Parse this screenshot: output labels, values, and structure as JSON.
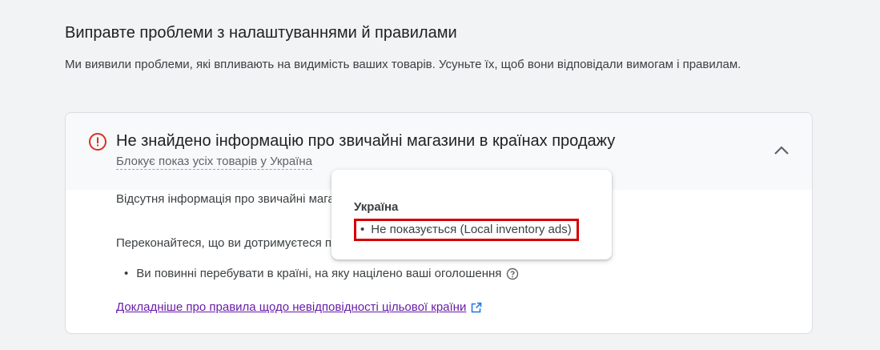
{
  "section": {
    "title": "Виправте проблеми з налаштуваннями й правилами",
    "description": "Ми виявили проблеми, які впливають на видимість ваших товарів. Усуньте їх, щоб вони відповідали вимогам і правилам."
  },
  "issue": {
    "icon": "error-icon",
    "title": "Не знайдено інформацію про звичайні магазини в країнах продажу",
    "subtitle": "Блокує показ усіх товарів у Україна",
    "collapse_icon": "chevron-up-icon",
    "body_p1": "Відсутня інформація про звичайні магазини в країнах, де ви продаєте товари",
    "body_p2": "Переконайтеся, що ви дотримуєтеся правил.",
    "bullet": "Ви повинні перебувати в країні, на яку націлено ваші оголошення",
    "help_icon": "help-icon",
    "link_text": "Докладніше про правила щодо невідповідності цільової країни",
    "link_icon": "open-in-new-icon"
  },
  "tooltip": {
    "country": "Україна",
    "item": "Не показується (Local inventory ads)"
  },
  "colors": {
    "error": "#d93025",
    "link": "#681da8",
    "highlight": "#d50000"
  }
}
